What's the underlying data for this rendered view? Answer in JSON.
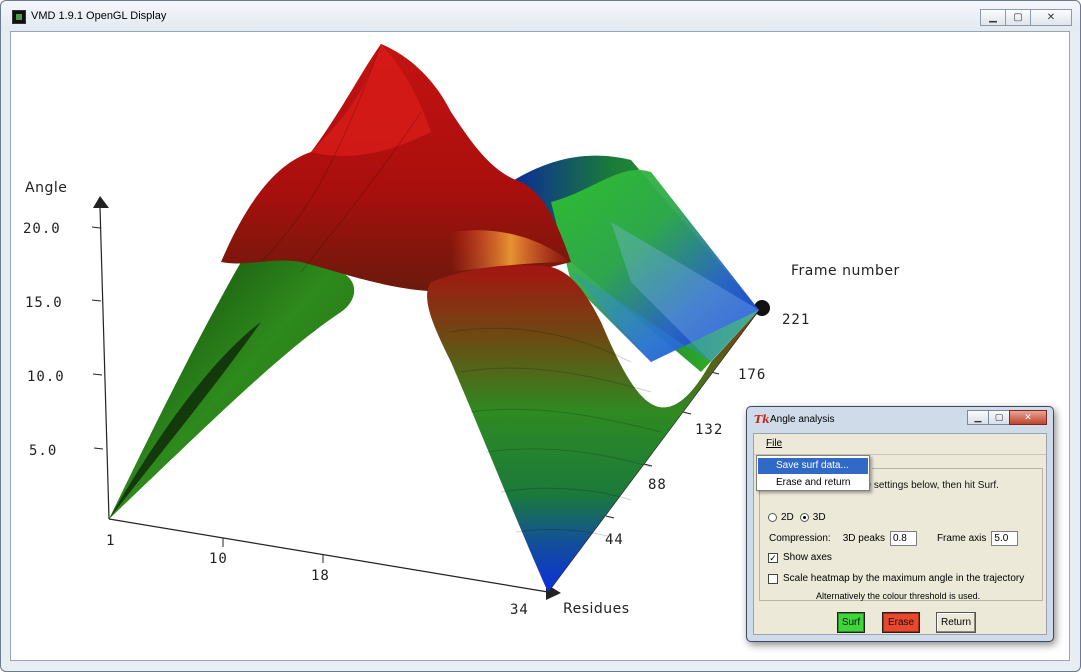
{
  "vmd_window": {
    "title": "VMD 1.9.1 OpenGL Display",
    "min_symbol": "▁",
    "max_symbol": "▢",
    "close_symbol": "✕"
  },
  "plot": {
    "y_axis_title": "Angle",
    "y_ticks": [
      "20.0",
      "15.0",
      "10.0",
      "5.0"
    ],
    "x_axis_title": "Residues",
    "x_ticks": [
      "1",
      "10",
      "18",
      "34"
    ],
    "z_axis_title": "Frame number",
    "z_ticks": [
      "44",
      "88",
      "132",
      "176",
      "221"
    ]
  },
  "dialog": {
    "title": "Angle analysis",
    "icon_glyph": "Tk",
    "min_symbol": "▁",
    "max_symbol": "▢",
    "close_symbol": "✕",
    "menu_file": "File",
    "group_label": "s",
    "instructions": "Please choose from the settings below, then hit Surf.",
    "radio_2d": "2D",
    "radio_3d": "3D",
    "compression_label": "Compression:",
    "peaks_label": "3D peaks",
    "peaks_value": "0.8",
    "frame_axis_label": "Frame axis",
    "frame_axis_value": "5.0",
    "show_axes_label": "Show axes",
    "show_axes_mark": "✓",
    "scale_label": "Scale heatmap by the maximum angle in the trajectory",
    "threshold_note": "Alternatively the colour threshold is used.",
    "surf_label": "Surf",
    "erase_label": "Erase",
    "return_label": "Return"
  },
  "file_menu": {
    "items": [
      "Save surf data...",
      "Erase and return"
    ]
  }
}
